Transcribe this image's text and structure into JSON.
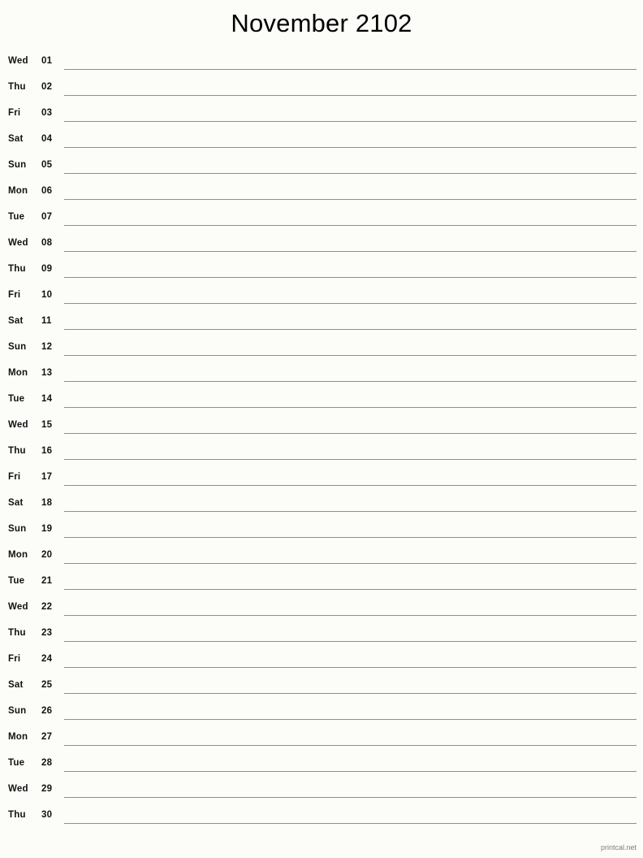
{
  "document": {
    "title": "November 2102",
    "month": "November",
    "year": "2102",
    "background_color": "#fcfdf8",
    "rule_color": "#8d918b",
    "text_color": "#111111"
  },
  "footer": {
    "label": "printcal.net",
    "color": "#7b7f79"
  },
  "calendar": {
    "days": [
      {
        "weekday": "Wed",
        "number": "01"
      },
      {
        "weekday": "Thu",
        "number": "02"
      },
      {
        "weekday": "Fri",
        "number": "03"
      },
      {
        "weekday": "Sat",
        "number": "04"
      },
      {
        "weekday": "Sun",
        "number": "05"
      },
      {
        "weekday": "Mon",
        "number": "06"
      },
      {
        "weekday": "Tue",
        "number": "07"
      },
      {
        "weekday": "Wed",
        "number": "08"
      },
      {
        "weekday": "Thu",
        "number": "09"
      },
      {
        "weekday": "Fri",
        "number": "10"
      },
      {
        "weekday": "Sat",
        "number": "11"
      },
      {
        "weekday": "Sun",
        "number": "12"
      },
      {
        "weekday": "Mon",
        "number": "13"
      },
      {
        "weekday": "Tue",
        "number": "14"
      },
      {
        "weekday": "Wed",
        "number": "15"
      },
      {
        "weekday": "Thu",
        "number": "16"
      },
      {
        "weekday": "Fri",
        "number": "17"
      },
      {
        "weekday": "Sat",
        "number": "18"
      },
      {
        "weekday": "Sun",
        "number": "19"
      },
      {
        "weekday": "Mon",
        "number": "20"
      },
      {
        "weekday": "Tue",
        "number": "21"
      },
      {
        "weekday": "Wed",
        "number": "22"
      },
      {
        "weekday": "Thu",
        "number": "23"
      },
      {
        "weekday": "Fri",
        "number": "24"
      },
      {
        "weekday": "Sat",
        "number": "25"
      },
      {
        "weekday": "Sun",
        "number": "26"
      },
      {
        "weekday": "Mon",
        "number": "27"
      },
      {
        "weekday": "Tue",
        "number": "28"
      },
      {
        "weekday": "Wed",
        "number": "29"
      },
      {
        "weekday": "Thu",
        "number": "30"
      }
    ]
  }
}
